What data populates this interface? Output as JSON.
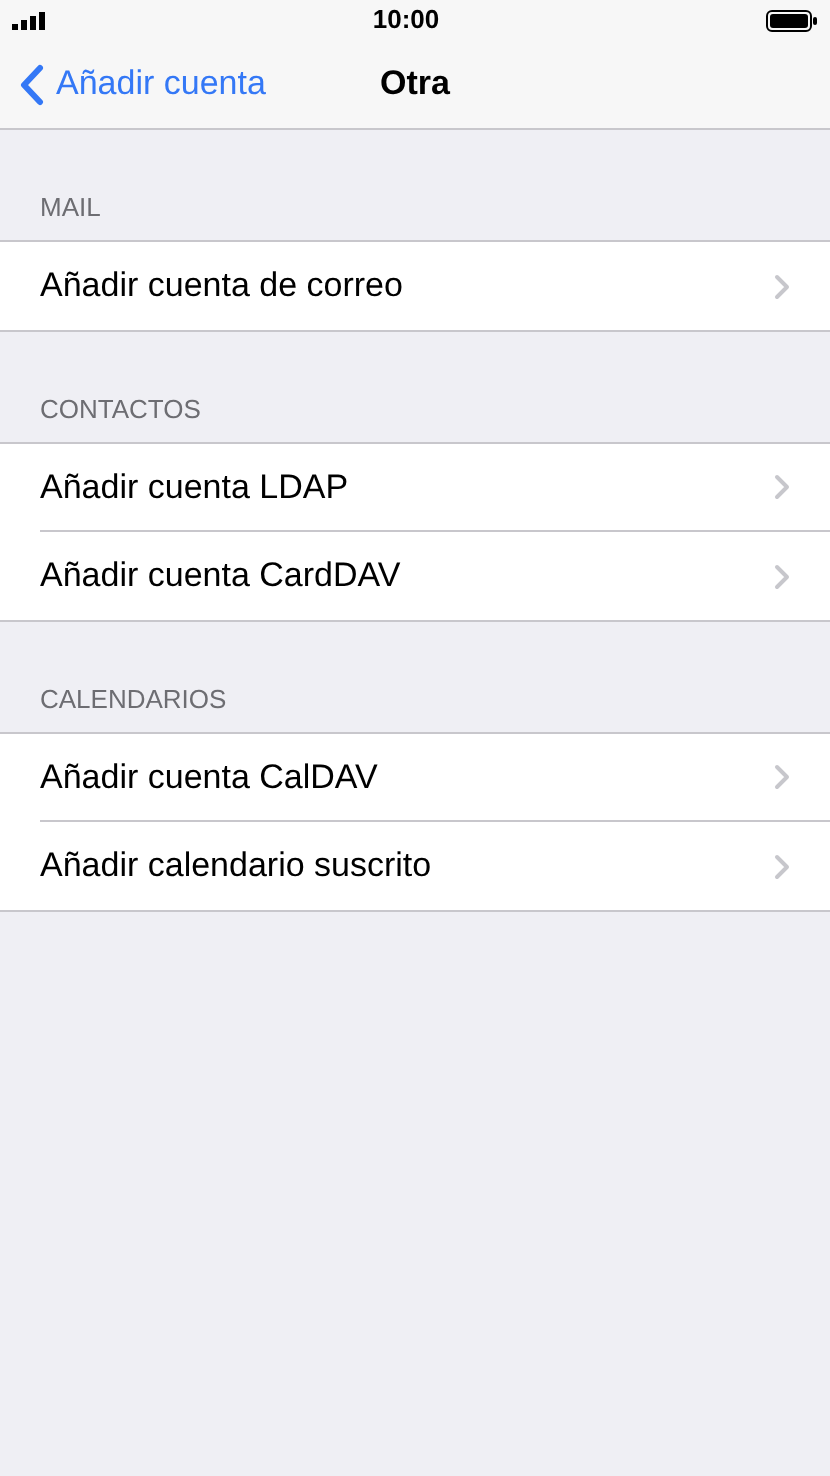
{
  "status_bar": {
    "time": "10:00"
  },
  "nav_bar": {
    "back": "Añadir cuenta",
    "title": "Otra"
  },
  "sections": [
    {
      "header": "MAIL",
      "rows": [
        {
          "label": "Añadir cuenta de correo"
        }
      ]
    },
    {
      "header": "CONTACTOS",
      "rows": [
        {
          "label": "Añadir cuenta LDAP"
        },
        {
          "label": "Añadir cuenta CardDAV"
        }
      ]
    },
    {
      "header": "CALENDARIOS",
      "rows": [
        {
          "label": "Añadir cuenta CalDAV"
        },
        {
          "label": "Añadir calendario suscrito"
        }
      ]
    }
  ]
}
